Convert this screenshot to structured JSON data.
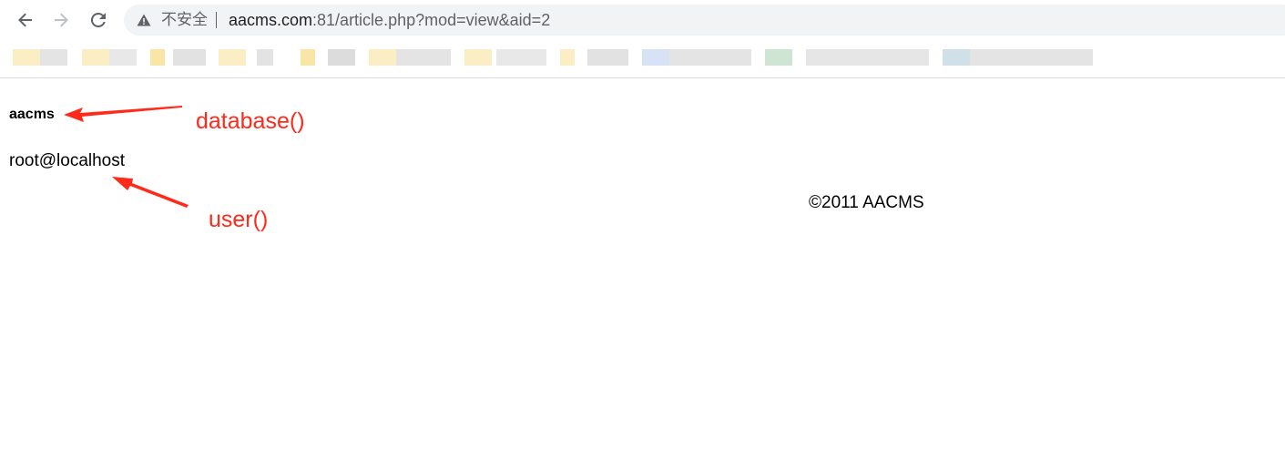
{
  "browser": {
    "security_label": "不安全",
    "url_host": "aacms.com",
    "url_rest": ":81/article.php?mod=view&aid=2"
  },
  "content": {
    "database_value": "aacms",
    "user_value": "root@localhost",
    "footer": "©2011 AACMS"
  },
  "annotations": {
    "database_label": "database()",
    "user_label": "user()",
    "color": "#ff2a1a"
  },
  "icons": {
    "back": "arrow-left-icon",
    "forward": "arrow-right-icon",
    "reload": "reload-icon",
    "security": "warning-triangle-icon"
  }
}
